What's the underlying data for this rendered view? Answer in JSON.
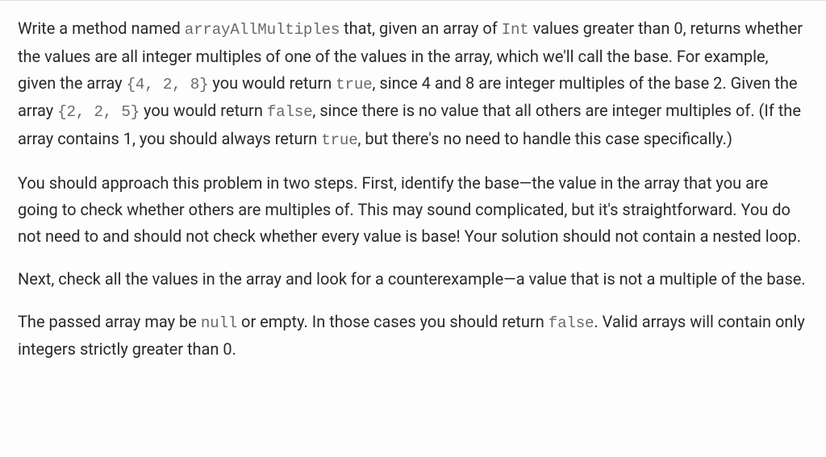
{
  "p1": {
    "t1": "Write a method named ",
    "c1": "arrayAllMultiples",
    "t2": " that, given an array of ",
    "c2": "Int",
    "t3": " values greater than 0, returns whether the values are all integer multiples of one of the values in the array, which we'll call the base. For example, given the array ",
    "c3": "{4, 2, 8}",
    "t4": " you would return ",
    "c4": "true",
    "t5": ", since 4 and 8 are integer multiples of the base 2. Given the array ",
    "c5": "{2, 2, 5}",
    "t6": " you would return ",
    "c6": "false",
    "t7": ", since there is no value that all others are integer multiples of. (If the array contains 1, you should always return ",
    "c7": "true",
    "t8": ", but there's no need to handle this case specifically.)"
  },
  "p2": {
    "t1": "You should approach this problem in two steps. First, identify the base—the value in the array that you are going to check whether others are multiples of. This may sound complicated, but it's straightforward. You do not need to and should not check whether every value is base! Your solution should not contain a nested loop."
  },
  "p3": {
    "t1": "Next, check all the values in the array and look for a counterexample—a value that is not a multiple of the base."
  },
  "p4": {
    "t1": "The passed array may be ",
    "c1": "null",
    "t2": " or empty. In those cases you should return ",
    "c2": "false",
    "t3": ". Valid arrays will contain only integers strictly greater than 0."
  }
}
